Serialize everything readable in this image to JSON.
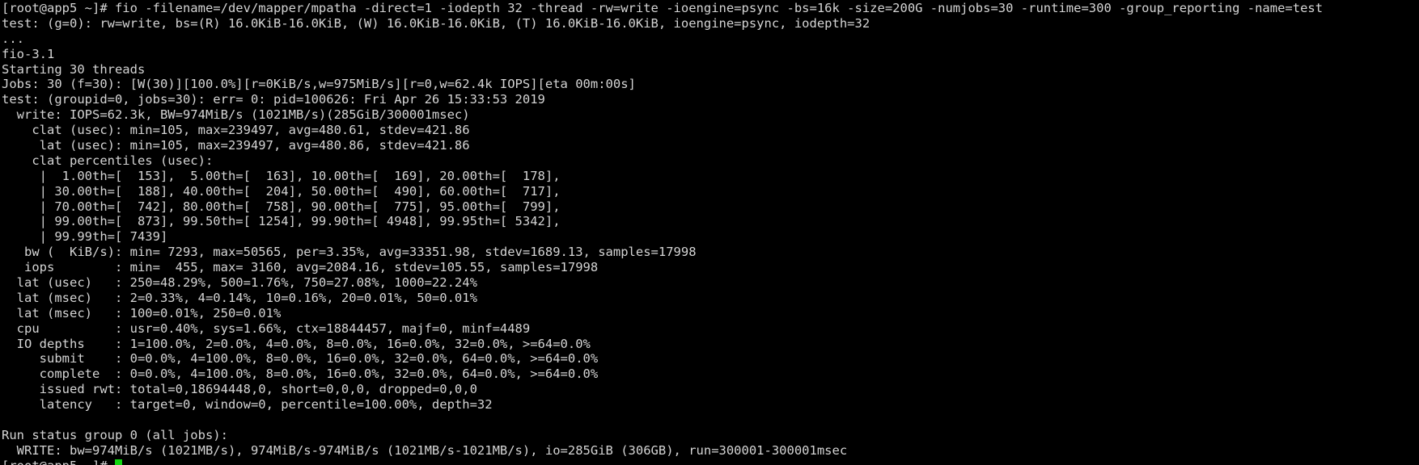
{
  "terminal": {
    "lines": [
      "[root@app5 ~]# fio -filename=/dev/mapper/mpatha -direct=1 -iodepth 32 -thread -rw=write -ioengine=psync -bs=16k -size=200G -numjobs=30 -runtime=300 -group_reporting -name=test",
      "test: (g=0): rw=write, bs=(R) 16.0KiB-16.0KiB, (W) 16.0KiB-16.0KiB, (T) 16.0KiB-16.0KiB, ioengine=psync, iodepth=32",
      "...",
      "fio-3.1",
      "Starting 30 threads",
      "Jobs: 30 (f=30): [W(30)][100.0%][r=0KiB/s,w=975MiB/s][r=0,w=62.4k IOPS][eta 00m:00s]",
      "test: (groupid=0, jobs=30): err= 0: pid=100626: Fri Apr 26 15:33:53 2019",
      "  write: IOPS=62.3k, BW=974MiB/s (1021MB/s)(285GiB/300001msec)",
      "    clat (usec): min=105, max=239497, avg=480.61, stdev=421.86",
      "     lat (usec): min=105, max=239497, avg=480.86, stdev=421.86",
      "    clat percentiles (usec):",
      "     |  1.00th=[  153],  5.00th=[  163], 10.00th=[  169], 20.00th=[  178],",
      "     | 30.00th=[  188], 40.00th=[  204], 50.00th=[  490], 60.00th=[  717],",
      "     | 70.00th=[  742], 80.00th=[  758], 90.00th=[  775], 95.00th=[  799],",
      "     | 99.00th=[  873], 99.50th=[ 1254], 99.90th=[ 4948], 99.95th=[ 5342],",
      "     | 99.99th=[ 7439]",
      "   bw (  KiB/s): min= 7293, max=50565, per=3.35%, avg=33351.98, stdev=1689.13, samples=17998",
      "   iops        : min=  455, max= 3160, avg=2084.16, stdev=105.55, samples=17998",
      "  lat (usec)   : 250=48.29%, 500=1.76%, 750=27.08%, 1000=22.24%",
      "  lat (msec)   : 2=0.33%, 4=0.14%, 10=0.16%, 20=0.01%, 50=0.01%",
      "  lat (msec)   : 100=0.01%, 250=0.01%",
      "  cpu          : usr=0.40%, sys=1.66%, ctx=18844457, majf=0, minf=4489",
      "  IO depths    : 1=100.0%, 2=0.0%, 4=0.0%, 8=0.0%, 16=0.0%, 32=0.0%, >=64=0.0%",
      "     submit    : 0=0.0%, 4=100.0%, 8=0.0%, 16=0.0%, 32=0.0%, 64=0.0%, >=64=0.0%",
      "     complete  : 0=0.0%, 4=100.0%, 8=0.0%, 16=0.0%, 32=0.0%, 64=0.0%, >=64=0.0%",
      "     issued rwt: total=0,18694448,0, short=0,0,0, dropped=0,0,0",
      "     latency   : target=0, window=0, percentile=100.00%, depth=32",
      "",
      "Run status group 0 (all jobs):",
      "  WRITE: bw=974MiB/s (1021MB/s), 974MiB/s-974MiB/s (1021MB/s-1021MB/s), io=285GiB (306GB), run=300001-300001msec"
    ],
    "prompt": "[root@app5 ~]# "
  },
  "colors": {
    "background": "#000000",
    "text": "#d4d4d4",
    "cursor": "#11d611"
  }
}
